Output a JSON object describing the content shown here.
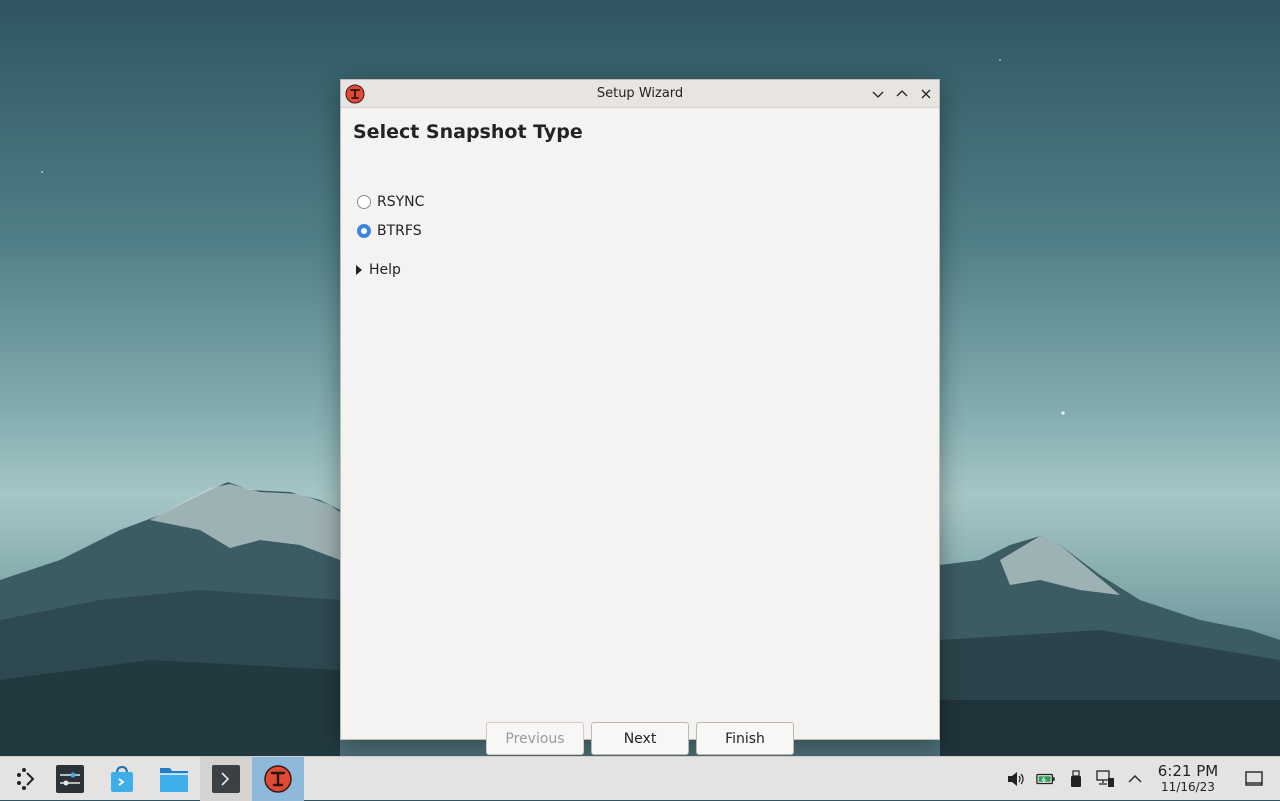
{
  "window": {
    "title": "Setup Wizard",
    "heading": "Select Snapshot Type",
    "options": [
      {
        "label": "RSYNC",
        "checked": false
      },
      {
        "label": "BTRFS",
        "checked": true
      }
    ],
    "help_label": "Help",
    "buttons": {
      "previous": "Previous",
      "next": "Next",
      "finish": "Finish"
    }
  },
  "taskbar": {
    "apps": [
      "application-launcher-icon",
      "system-settings-icon",
      "discover-store-icon",
      "file-manager-icon",
      "terminal-icon",
      "timeshift-icon"
    ],
    "active_app": "timeshift-icon",
    "clock": {
      "time": "6:21 PM",
      "date": "11/16/23"
    }
  },
  "colors": {
    "accent": "#3c86e0",
    "active_task": "#8fb9db",
    "app_icon": "#e04a35"
  }
}
